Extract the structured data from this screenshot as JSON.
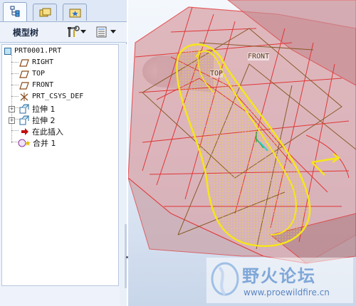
{
  "tabs": [
    {
      "icon": "model-tree-icon",
      "active": true
    },
    {
      "icon": "folder-browser-icon",
      "active": false
    },
    {
      "icon": "favorites-icon",
      "active": false
    }
  ],
  "panel": {
    "title": "模型树",
    "settings_icon": "tree-settings-icon",
    "columns_icon": "tree-columns-icon"
  },
  "tree": {
    "root": "PRT0001.PRT",
    "items": [
      {
        "label": "RIGHT",
        "icon": "datum-plane-icon"
      },
      {
        "label": "TOP",
        "icon": "datum-plane-icon"
      },
      {
        "label": "FRONT",
        "icon": "datum-plane-icon"
      },
      {
        "label": "PRT_CSYS_DEF",
        "icon": "csys-icon"
      },
      {
        "label": "拉伸 1",
        "icon": "extrude-icon"
      },
      {
        "label": "拉伸 2",
        "icon": "extrude-icon"
      },
      {
        "label": "在此插入",
        "icon": "insert-here-icon"
      },
      {
        "label": "合并 1",
        "icon": "merge-icon"
      }
    ]
  },
  "viewport": {
    "datum_labels": [
      "FRONT",
      "TOP"
    ],
    "watermark_text": "野火论坛",
    "watermark_url": "www.proewildfire.cn",
    "colors": {
      "surface_red": "#e03030",
      "selection_yellow": "#f6e61a",
      "datum_brown": "#8a5a2a"
    }
  }
}
